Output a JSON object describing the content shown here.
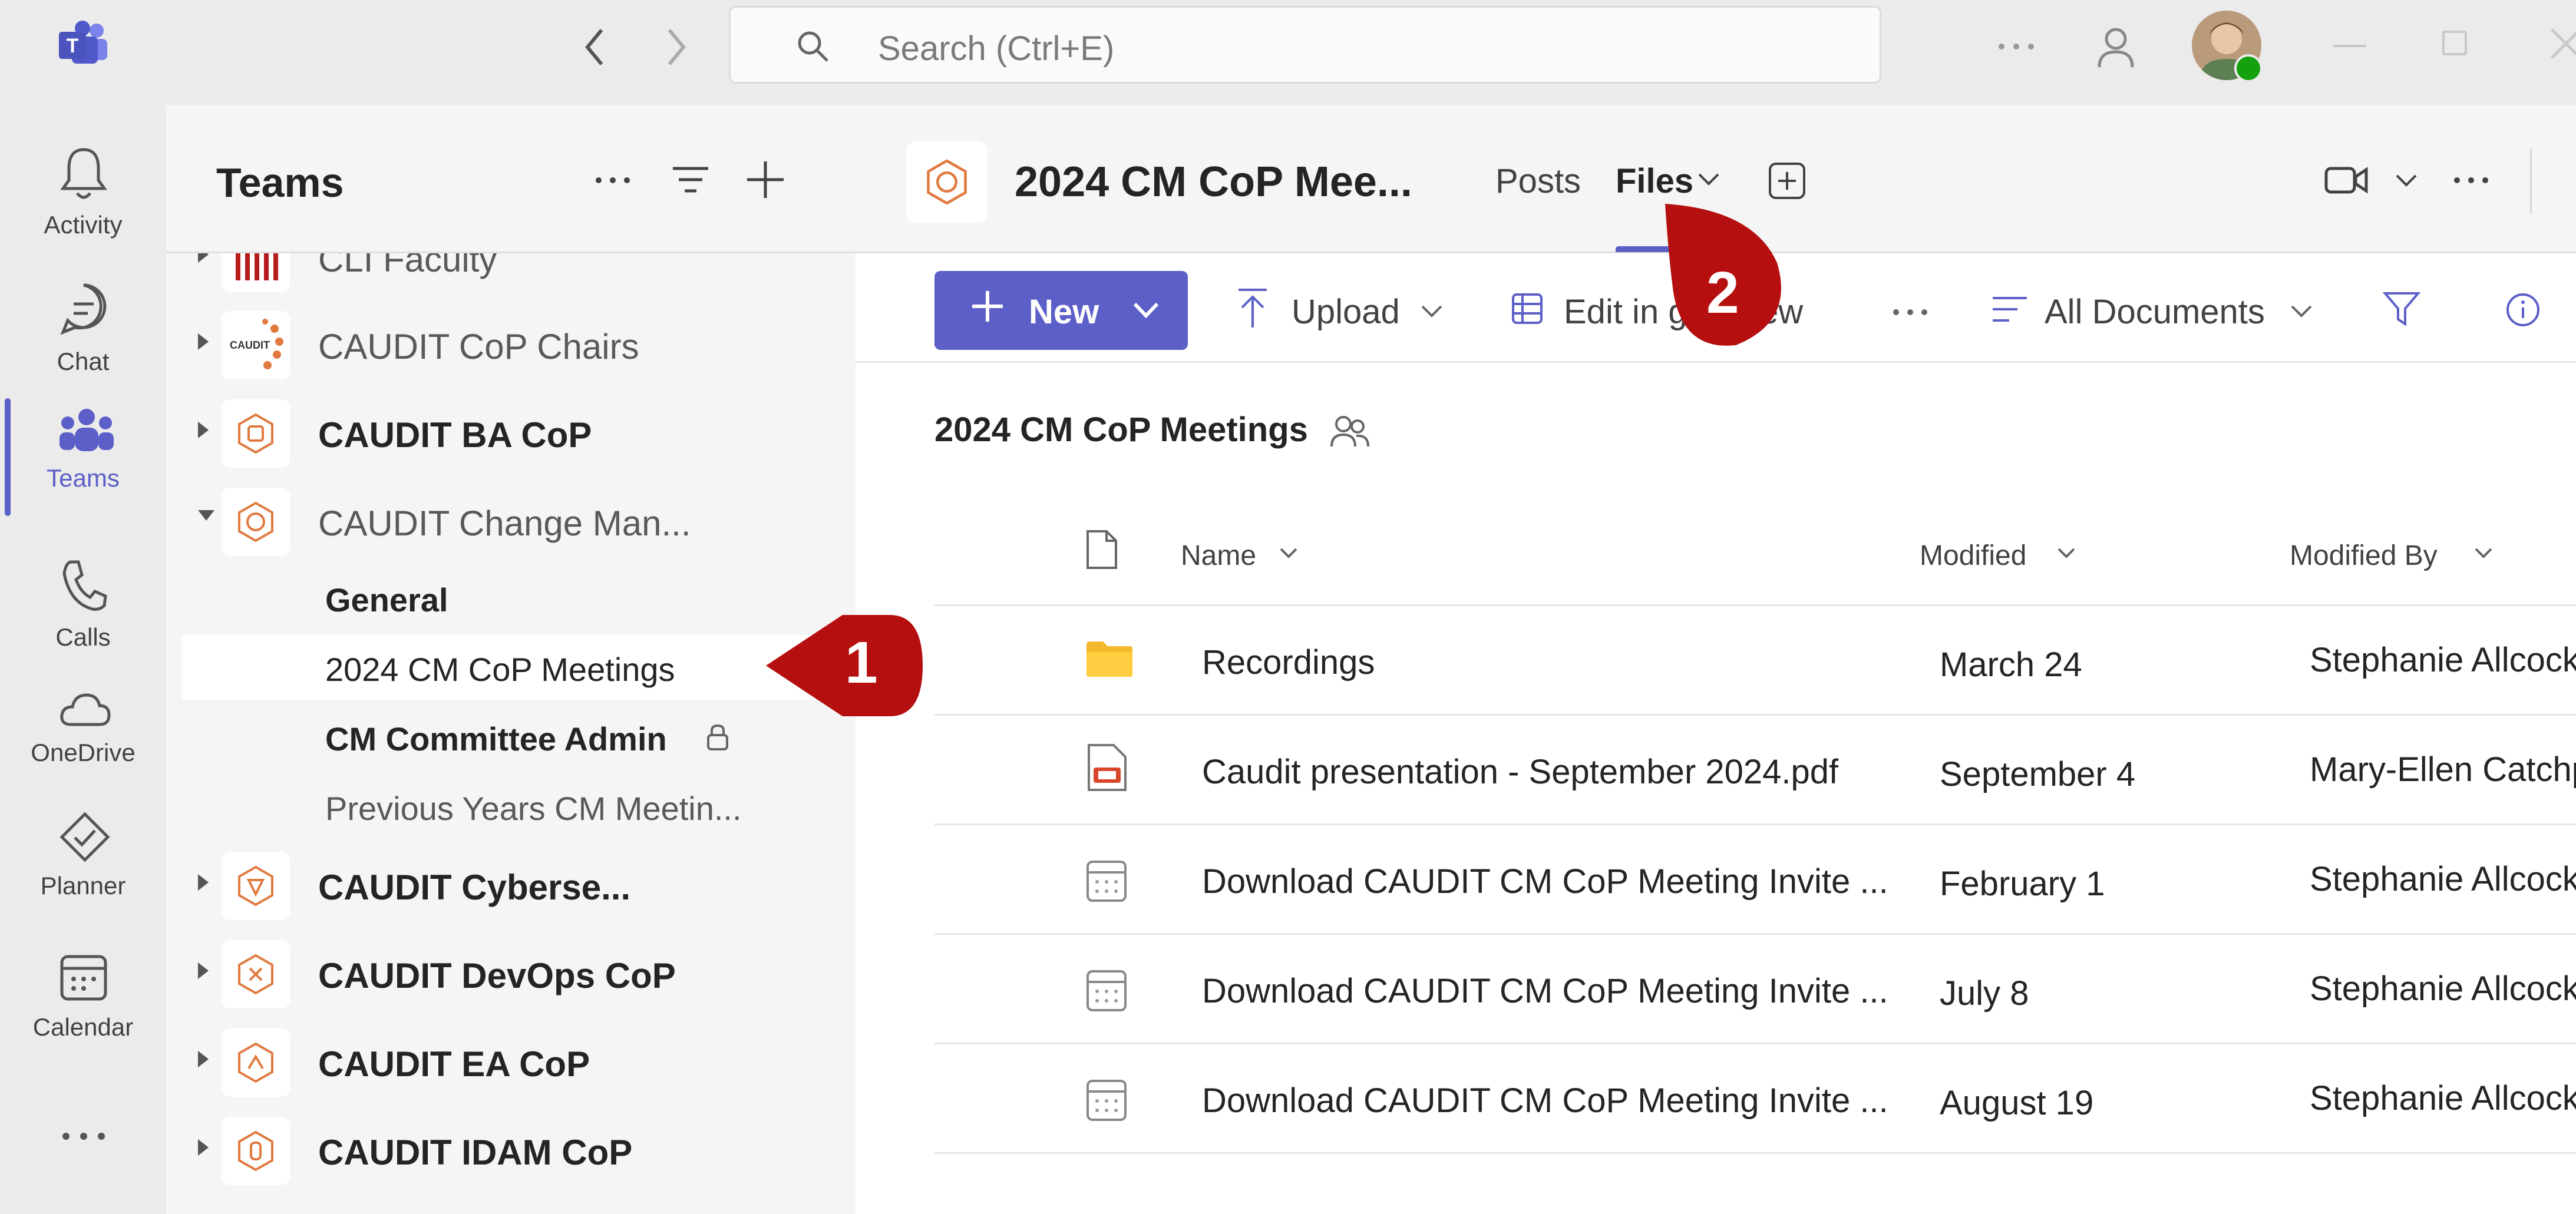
{
  "titlebar": {
    "search_placeholder": "Search (Ctrl+E)"
  },
  "rail": {
    "items": [
      {
        "label": "Activity",
        "icon": "bell-icon"
      },
      {
        "label": "Chat",
        "icon": "chat-icon"
      },
      {
        "label": "Teams",
        "icon": "teams-icon",
        "active": true
      },
      {
        "label": "Calls",
        "icon": "phone-icon"
      },
      {
        "label": "OneDrive",
        "icon": "cloud-icon"
      },
      {
        "label": "Planner",
        "icon": "planner-icon"
      },
      {
        "label": "Calendar",
        "icon": "calendar-icon"
      }
    ]
  },
  "teams_pane": {
    "title": "Teams",
    "teams": [
      {
        "name": "CLI Faculty"
      },
      {
        "name": "CAUDIT CoP Chairs"
      },
      {
        "name": "CAUDIT BA CoP"
      },
      {
        "name": "CAUDIT Change Man..."
      },
      {
        "name": "CAUDIT Cyberse..."
      },
      {
        "name": "CAUDIT DevOps CoP"
      },
      {
        "name": "CAUDIT EA CoP"
      },
      {
        "name": "CAUDIT IDAM CoP"
      }
    ],
    "channels": [
      {
        "name": "General"
      },
      {
        "name": "2024 CM CoP Meetings"
      },
      {
        "name": "CM Committee Admin"
      },
      {
        "name": "Previous Years CM Meetin..."
      }
    ]
  },
  "channel": {
    "title": "2024 CM CoP Mee...",
    "tabs": {
      "posts": "Posts",
      "files": "Files"
    }
  },
  "toolbar": {
    "new_label": "New",
    "upload_label": "Upload",
    "edit_label": "Edit in grid view",
    "view_label": "All Documents"
  },
  "library": {
    "title": "2024 CM CoP Meetings",
    "columns": {
      "name": "Name",
      "modified": "Modified",
      "modified_by": "Modified By"
    },
    "rows": [
      {
        "name": "Recordings",
        "modified": "March 24",
        "modified_by": "Stephanie Allcock",
        "type": "folder"
      },
      {
        "name": "Caudit presentation - September 2024.pdf",
        "modified": "September 4",
        "modified_by": "Mary-Ellen Catchpole",
        "type": "pdf"
      },
      {
        "name": "Download CAUDIT CM CoP Meeting Invite ...",
        "modified": "February 1",
        "modified_by": "Stephanie Allcock",
        "type": "calendar"
      },
      {
        "name": "Download CAUDIT CM CoP Meeting Invite ...",
        "modified": "July 8",
        "modified_by": "Stephanie Allcock",
        "type": "calendar"
      },
      {
        "name": "Download CAUDIT CM CoP Meeting Invite ...",
        "modified": "August 19",
        "modified_by": "Stephanie Allcock",
        "type": "calendar"
      }
    ]
  },
  "callouts": {
    "one": "1",
    "two": "2"
  },
  "colors": {
    "accent": "#5b5fc7",
    "callout": "#b50f0f",
    "brand_orange": "#e07a3f"
  }
}
